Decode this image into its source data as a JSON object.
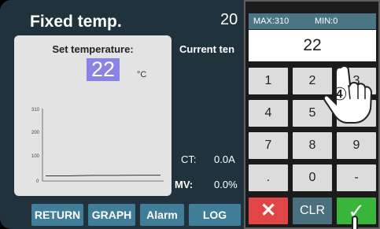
{
  "header": {
    "title": "Fixed temp.",
    "time_partial": "20"
  },
  "setpoint": {
    "label": "Set temperature:",
    "value": "22",
    "unit": "°C"
  },
  "current": {
    "label": "Current ten"
  },
  "chart_data": {
    "type": "line",
    "y_ticks": [
      "310",
      "200",
      "100",
      "0"
    ],
    "ylim": [
      0,
      310
    ],
    "series": [
      {
        "values": [
          22,
          22,
          24,
          24,
          25,
          25
        ]
      }
    ]
  },
  "readouts": {
    "ct_label": "CT:",
    "ct_value": "0.0A",
    "mv_label": "MV:",
    "mv_value": "0.0%"
  },
  "nav": {
    "return": "RETURN",
    "graph": "GRAPH",
    "alarm": "Alarm",
    "log": "LOG"
  },
  "keypad": {
    "max_label": "MAX:310",
    "min_label": "MIN:0",
    "display": "22",
    "keys": [
      "1",
      "2",
      "3",
      "4",
      "5",
      "6",
      "7",
      "8",
      "9",
      ".",
      "0",
      "-"
    ],
    "clear": "CLR",
    "cancel_symbol": "✕",
    "ok_symbol": "✓",
    "step_label": "④"
  },
  "colors": {
    "cancel": "#e24545",
    "ok": "#38b53a",
    "nav": "#3f7d98",
    "highlight": "#8a83e6"
  }
}
